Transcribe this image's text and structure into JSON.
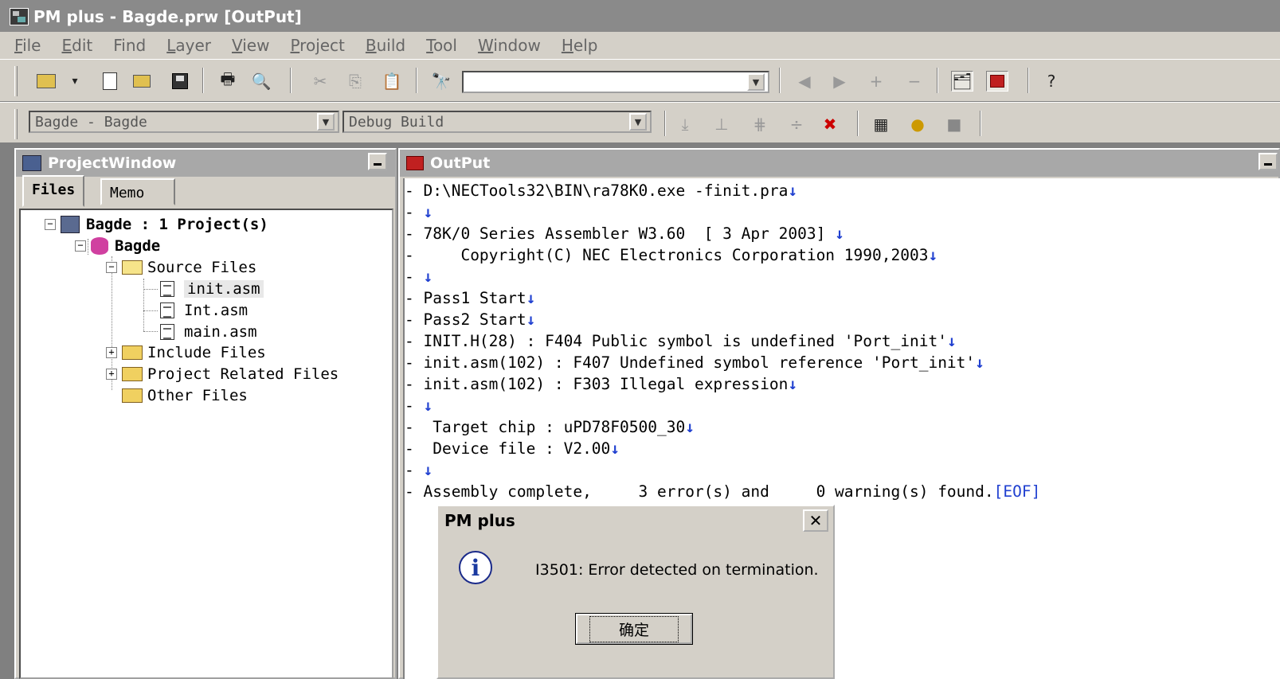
{
  "window": {
    "title": "PM plus - Bagde.prw [OutPut]"
  },
  "menu": [
    {
      "label": "File",
      "u": "F",
      "rest": "ile"
    },
    {
      "label": "Edit",
      "u": "E",
      "rest": "dit"
    },
    {
      "label": "Find",
      "u": "Fin",
      "rest": "d",
      "u_last": true
    },
    {
      "label": "Layer",
      "u": "L",
      "rest": "ayer"
    },
    {
      "label": "View",
      "u": "V",
      "rest": "iew"
    },
    {
      "label": "Project",
      "u": "P",
      "rest": "roject"
    },
    {
      "label": "Build",
      "u": "B",
      "rest": "uild"
    },
    {
      "label": "Tool",
      "u": "T",
      "rest": "ool"
    },
    {
      "label": "Window",
      "u": "W",
      "rest": "indow"
    },
    {
      "label": "Help",
      "u": "H",
      "rest": "elp"
    }
  ],
  "toolbar2": {
    "project_combo": "Bagde - Bagde",
    "build_combo": "Debug Build"
  },
  "project_window": {
    "title": "ProjectWindow",
    "tabs": [
      "Files",
      "Memo"
    ],
    "tree": {
      "root": "Bagde : 1 Project(s)",
      "project": "Bagde",
      "source_folder": "Source Files",
      "source_files": [
        "init.asm",
        "Int.asm",
        "main.asm"
      ],
      "include_folder": "Include Files",
      "related_folder": "Project Related Files",
      "other_folder": "Other Files"
    }
  },
  "output_window": {
    "title": "OutPut",
    "lines": [
      {
        "dash": "-",
        "text": " D:\\NECTools32\\BIN\\ra78K0.exe -finit.pra",
        "arrow": "↓"
      },
      {
        "dash": "-",
        "text": " ",
        "arrow": "↓"
      },
      {
        "dash": "-",
        "text": " 78K/0 Series Assembler W3.60  [ 3 Apr 2003] ",
        "arrow": "↓"
      },
      {
        "dash": "-",
        "text": "     Copyright(C) NEC Electronics Corporation 1990,2003",
        "arrow": "↓"
      },
      {
        "dash": "-",
        "text": " ",
        "arrow": "↓"
      },
      {
        "dash": "-",
        "text": " Pass1 Start",
        "arrow": "↓"
      },
      {
        "dash": "-",
        "text": " Pass2 Start",
        "arrow": "↓"
      },
      {
        "dash": "-",
        "text": " INIT.H(28) : F404 Public symbol is undefined 'Port_init'",
        "arrow": "↓"
      },
      {
        "dash": "-",
        "text": " init.asm(102) : F407 Undefined symbol reference 'Port_init'",
        "arrow": "↓"
      },
      {
        "dash": "-",
        "text": " init.asm(102) : F303 Illegal expression",
        "arrow": "↓"
      },
      {
        "dash": "-",
        "text": " ",
        "arrow": "↓"
      },
      {
        "dash": "-",
        "text": "  Target chip : uPD78F0500_30",
        "arrow": "↓"
      },
      {
        "dash": "-",
        "text": "  Device file : V2.00",
        "arrow": "↓"
      },
      {
        "dash": "-",
        "text": " ",
        "arrow": "↓"
      },
      {
        "dash": "-",
        "text": " Assembly complete,     3 error(s) and     0 warning(s) found.",
        "arrow": "",
        "eof": "[EOF]"
      }
    ]
  },
  "dialog": {
    "title": "PM plus",
    "close_label": "✕",
    "message": "I3501: Error detected on termination.",
    "ok_label": "确定",
    "info_icon": "i"
  }
}
